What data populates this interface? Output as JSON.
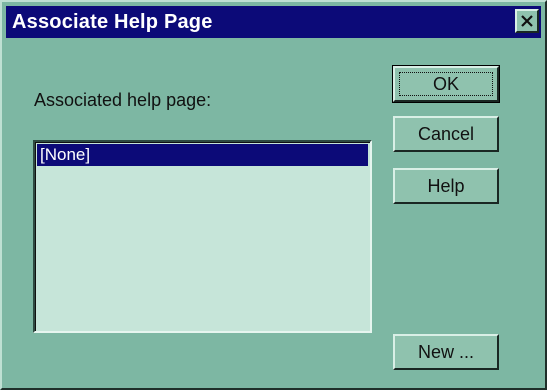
{
  "window": {
    "title": "Associate Help Page",
    "close_icon": "close-icon"
  },
  "form": {
    "label": "Associated help page:",
    "list_items": [
      "[None]"
    ],
    "selected_index": 0
  },
  "buttons": {
    "ok_label": "OK",
    "cancel_label": "Cancel",
    "help_label": "Help",
    "new_label": "New ..."
  },
  "colors": {
    "titlebar": "#0c0a78",
    "face": "#7db7a3",
    "list_background": "#c6e5d9",
    "selection": "#0c0a78"
  }
}
